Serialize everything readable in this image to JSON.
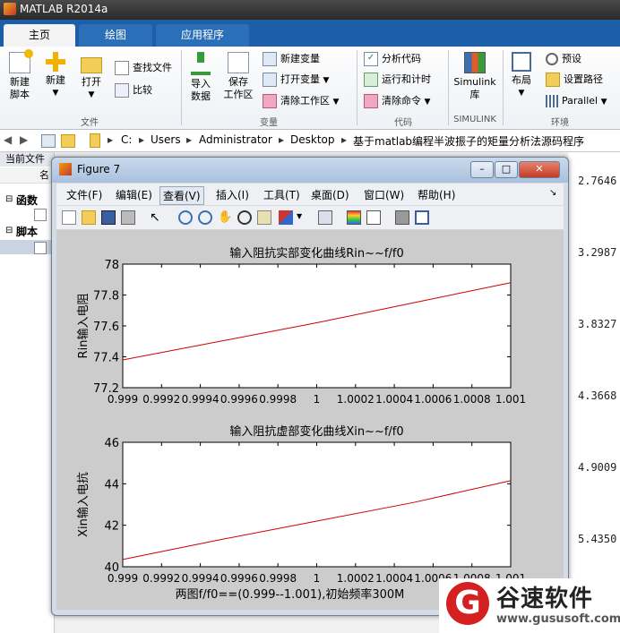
{
  "app": {
    "title": "MATLAB R2014a"
  },
  "tabs": [
    {
      "label": "主页"
    },
    {
      "label": "绘图"
    },
    {
      "label": "应用程序"
    }
  ],
  "ribbon": {
    "new_script": "新建\n脚本",
    "new_script_l1": "新建",
    "new_script_l2": "脚本",
    "new": "新建",
    "open": "打开",
    "find_files": "查找文件",
    "compare": "比较",
    "group_file": "文件",
    "import_l1": "导入",
    "import_l2": "数据",
    "save_l1": "保存",
    "save_l2": "工作区",
    "new_variable": "新建变量",
    "open_variable": "打开变量",
    "clear_workspace": "清除工作区",
    "group_variable": "变量",
    "analyze_code": "分析代码",
    "run_time": "运行和计时",
    "clear_commands": "清除命令",
    "group_code": "代码",
    "simulink_l1": "Simulink",
    "simulink_l2": "库",
    "group_simulink": "SIMULINK",
    "layout": "布局",
    "preferences": "预设",
    "set_path": "设置路径",
    "parallel": "Parallel",
    "group_env": "环境"
  },
  "address": {
    "segments": [
      "C:",
      "Users",
      "Administrator",
      "Desktop",
      "基于matlab编程半波振子的矩量分析法源码程序"
    ]
  },
  "left_panel": {
    "header": "当前文件",
    "col": "名",
    "functions": "函数",
    "scripts": "脚本"
  },
  "right_panel": {
    "values": [
      "2.7646",
      "3.2987",
      "3.8327",
      "4.3668",
      "4.9009",
      "5.4350"
    ]
  },
  "figure": {
    "title": "Figure 7",
    "menus": [
      "文件(F)",
      "编辑(E)",
      "查看(V)",
      "插入(I)",
      "工具(T)",
      "桌面(D)",
      "窗口(W)",
      "帮助(H)"
    ]
  },
  "chart_data": [
    {
      "type": "line",
      "title": "输入阻抗实部变化曲线Rin~~f/f0",
      "xlabel": "",
      "ylabel": "Rin输入电阻",
      "xlim": [
        0.999,
        1.001
      ],
      "ylim": [
        77.2,
        78
      ],
      "xticks": [
        "0.999",
        "0.9992",
        "0.9994",
        "0.9996",
        "0.9998",
        "1",
        "1.0002",
        "1.0004",
        "1.0006",
        "1.0008",
        "1.001"
      ],
      "yticks": [
        "77.2",
        "77.4",
        "77.6",
        "77.8",
        "78"
      ],
      "series": [
        {
          "color": "#cc0000",
          "x": [
            0.999,
            0.9995,
            1.0,
            1.0005,
            1.001
          ],
          "y": [
            77.38,
            77.5,
            77.62,
            77.75,
            77.88
          ]
        }
      ]
    },
    {
      "type": "line",
      "title": "输入阻抗虚部变化曲线Xin~~f/f0",
      "xlabel": "两图f/f0==(0.999--1.001),初始频率300M",
      "ylabel": "Xin输入电抗",
      "xlim": [
        0.999,
        1.001
      ],
      "ylim": [
        40,
        46
      ],
      "xticks": [
        "0.999",
        "0.9992",
        "0.9994",
        "0.9996",
        "0.9998",
        "1",
        "1.0002",
        "1.0004",
        "1.0006",
        "1.0008",
        "1.001"
      ],
      "yticks": [
        "40",
        "42",
        "44",
        "46"
      ],
      "series": [
        {
          "color": "#cc0000",
          "x": [
            0.999,
            0.9995,
            1.0,
            1.0005,
            1.001
          ],
          "y": [
            40.35,
            41.3,
            42.2,
            43.1,
            44.15
          ]
        }
      ]
    }
  ],
  "watermark": {
    "brand": "谷速软件",
    "url": "www.gususoft.com",
    "letter": "G"
  }
}
